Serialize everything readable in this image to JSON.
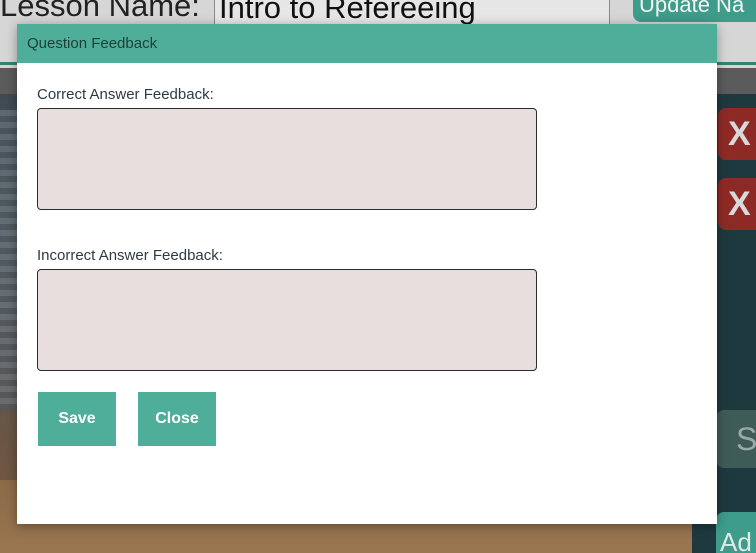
{
  "background": {
    "lesson_label": "Lesson Name:",
    "lesson_name_value": "Intro to Refereeing",
    "update_button_label": "Update Na",
    "delete_buttons": [
      "X",
      "X"
    ],
    "side_button_label": "S",
    "add_button_label": "Ad"
  },
  "modal": {
    "title": "Question Feedback",
    "correct_label": "Correct Answer Feedback:",
    "correct_value": "",
    "incorrect_label": "Incorrect Answer Feedback:",
    "incorrect_value": "",
    "save_label": "Save",
    "close_label": "Close"
  },
  "colors": {
    "accent": "#4fae99",
    "textarea_bg": "#e8dede",
    "delete_red": "#8e2a26"
  }
}
